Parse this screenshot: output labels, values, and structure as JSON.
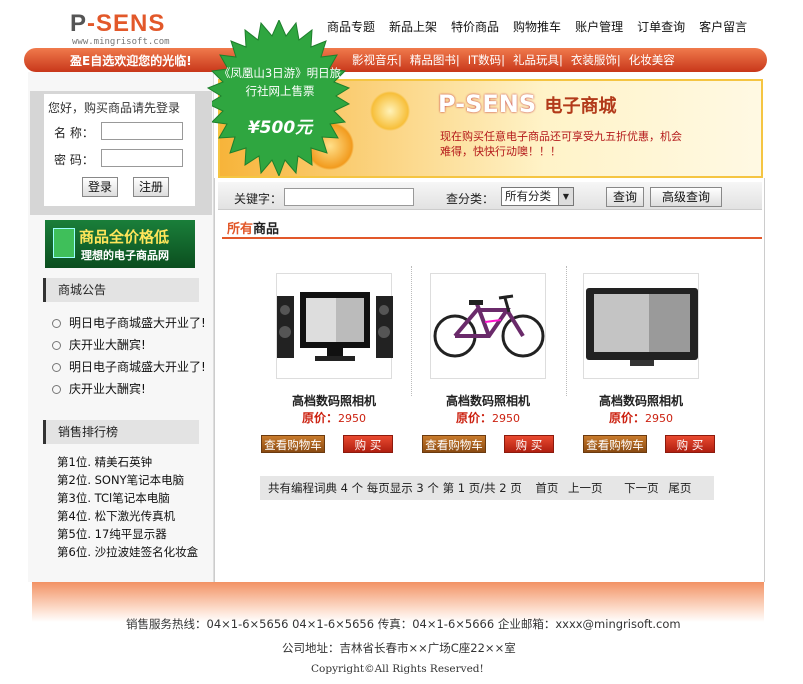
{
  "logo": {
    "mark_a": "P",
    "mark_b": "-SENS",
    "url": "www.mingrisoft.com"
  },
  "topnav": [
    "商品专题",
    "新品上架",
    "特价商品",
    "购物推车",
    "账户管理",
    "订单查询",
    "客户留言"
  ],
  "welcome": "盈E自选欢迎您的光临!",
  "catnav": [
    "影视音乐|",
    "精品图书|",
    "IT数码|",
    "礼品玩具|",
    "衣装服饰|",
    "化妆美容"
  ],
  "starburst": {
    "text": "《凤凰山3日游》明日旅行社网上售票",
    "price": "¥500元"
  },
  "banner": {
    "logo": "P-SENS",
    "logo_sub": "电子商城",
    "text": "现在购买任意电子商品还可享受九五折优惠，机会难得，快快行动噢！！！"
  },
  "login": {
    "title": "您好，购买商品请先登录",
    "name_label": "名  称：",
    "pwd_label": "密  码：",
    "login_btn": "登录",
    "register_btn": "注册"
  },
  "promo": {
    "line1": "商品全价格低",
    "line2": "理想的电子商品网"
  },
  "notices": {
    "title": "商城公告",
    "items": [
      "明日电子商城盛大开业了!",
      "庆开业大酬宾!",
      "明日电子商城盛大开业了!",
      "庆开业大酬宾!"
    ]
  },
  "ranking": {
    "title": "销售排行榜",
    "items": [
      "第1位. 精美石英钟",
      "第2位. SONY笔记本电脑",
      "第3位. TCl笔记本电脑",
      "第4位. 松下激光传真机",
      "第5位. 17纯平显示器",
      "第6位. 沙拉波娃签名化妆盒"
    ]
  },
  "search": {
    "keyword_label": "关键字：",
    "category_label": "查分类：",
    "category_value": "所有分类",
    "query_btn": "查询",
    "advanced_btn": "高级查询"
  },
  "section": {
    "title_a": "所有",
    "title_b": "商品"
  },
  "products": [
    {
      "icon": "monitor-speakers-icon",
      "name": "高档数码照相机",
      "price_label": "原价：",
      "price": "2950",
      "cart": "查看购物车",
      "buy": "购 买"
    },
    {
      "icon": "bicycle-icon",
      "name": "高档数码照相机",
      "price_label": "原价：",
      "price": "2950",
      "cart": "查看购物车",
      "buy": "购 买"
    },
    {
      "icon": "flat-tv-icon",
      "name": "高档数码照相机",
      "price_label": "原价：",
      "price": "2950",
      "cart": "查看购物车",
      "buy": "购 买"
    }
  ],
  "pager": {
    "summary": "共有编程词典 4 个 每页显示 3 个 第 1 页/共 2 页",
    "first": "首页",
    "prev": "上一页",
    "next": "下一页",
    "last": "尾页"
  },
  "footer": {
    "line1": "销售服务热线：04×1-6×5656 04×1-6×5656   传真：04×1-6×5666   企业邮箱：xxxx@mingrisoft.com",
    "line2": "公司地址：吉林省长春市××广场C座22××室",
    "line3": "Copyright©All Rights Reserved!"
  }
}
